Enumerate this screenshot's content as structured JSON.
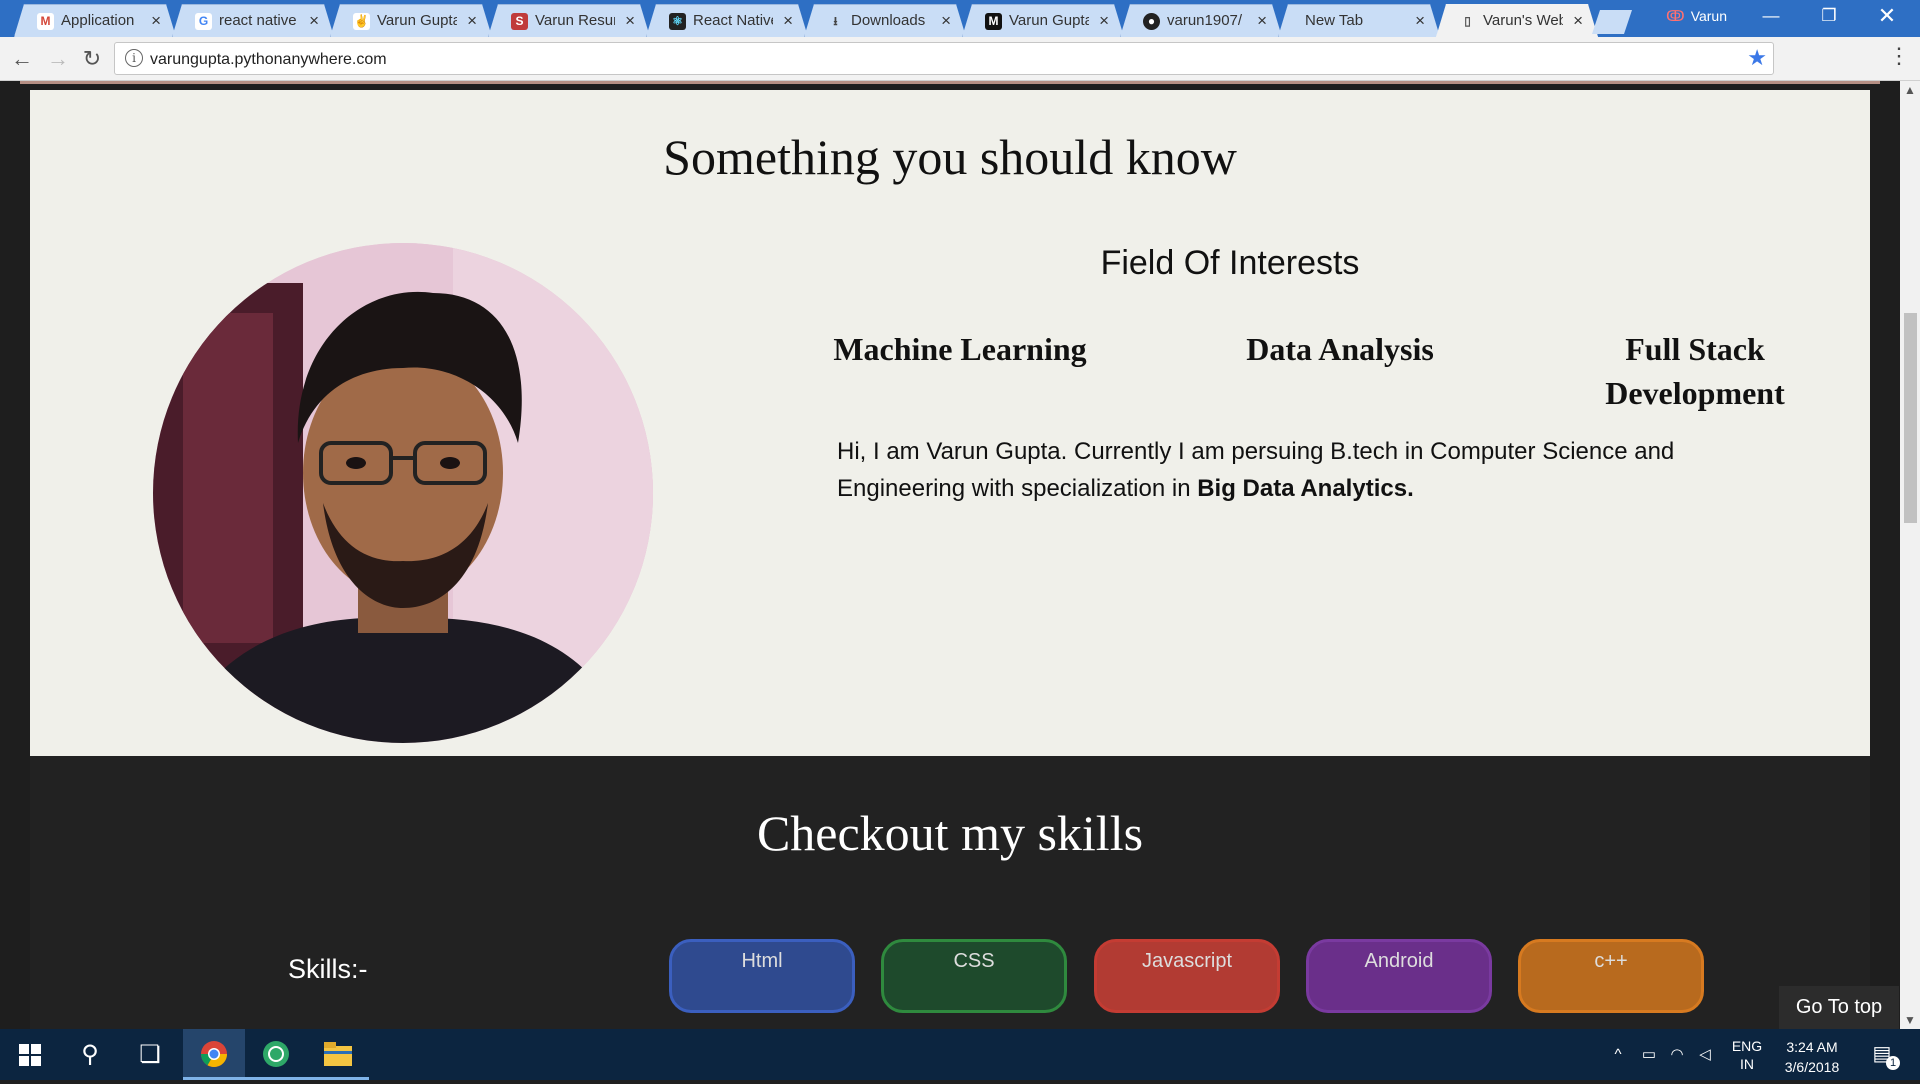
{
  "browser": {
    "tabs": [
      {
        "title": "Application",
        "icon": "gmail-icon",
        "close": "×"
      },
      {
        "title": "react native",
        "icon": "google-icon",
        "close": "×"
      },
      {
        "title": "Varun Gupta",
        "icon": "angellist-icon",
        "close": "×"
      },
      {
        "title": "Varun Resum",
        "icon": "s-letter-icon",
        "close": "×"
      },
      {
        "title": "React Native",
        "icon": "react-icon",
        "close": "×"
      },
      {
        "title": "Downloads",
        "icon": "download-icon",
        "close": "×"
      },
      {
        "title": "Varun Gupta",
        "icon": "medium-icon",
        "close": "×"
      },
      {
        "title": "varun1907/",
        "icon": "github-icon",
        "close": "×"
      },
      {
        "title": "New Tab",
        "icon": "",
        "close": "×"
      },
      {
        "title": "Varun's Web",
        "icon": "page-icon",
        "close": "×",
        "active": true
      }
    ],
    "profile_name": "Varun",
    "url": "varungupta.pythonanywhere.com"
  },
  "page": {
    "about_title": "Something you should know",
    "field_of_interests_title": "Field Of Interests",
    "interests": [
      "Machine Learning",
      "Data Analysis",
      "Full Stack Development"
    ],
    "bio_prefix": "Hi, I am Varun Gupta. Currently I am persuing B.tech in Computer Science and Engineering with specialization in ",
    "bio_bold": "Big Data Analytics",
    "bio_suffix": ".",
    "skills_title": "Checkout my skills",
    "skills_label": "Skills:-",
    "skills": [
      {
        "name": "Html",
        "color": "#2f4a8f",
        "border": "#3b5fbf"
      },
      {
        "name": "CSS",
        "color": "#1e4a2c",
        "border": "#2f8a3e"
      },
      {
        "name": "Javascript",
        "color": "#b23b33",
        "border": "#c43c33"
      },
      {
        "name": "Android",
        "color": "#6a2f8a",
        "border": "#7a3aa0"
      },
      {
        "name": "c++",
        "color": "#b86a1e",
        "border": "#d77a20"
      }
    ],
    "go_to_top": "Go To top"
  },
  "taskbar": {
    "lang_line1": "ENG",
    "lang_line2": "IN",
    "time": "3:24 AM",
    "date": "3/6/2018",
    "notification_count": "1"
  }
}
